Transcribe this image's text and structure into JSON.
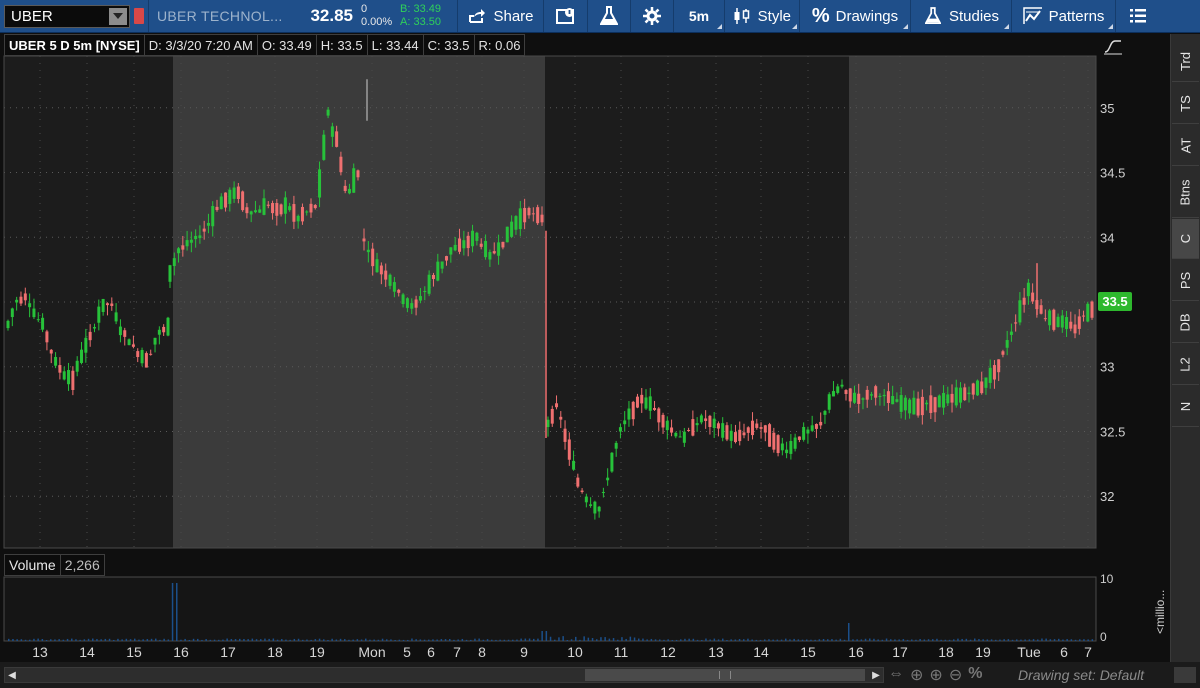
{
  "toolbar": {
    "symbol": "UBER",
    "company": "UBER TECHNOL...",
    "last": "32.85",
    "net_change": "0",
    "net_change_pct": "0.00%",
    "bid": "B: 33.49",
    "ask": "A: 33.50",
    "share_label": "Share",
    "aggregation": "5m",
    "style_label": "Style",
    "drawings_label": "Drawings",
    "studies_label": "Studies",
    "patterns_label": "Patterns",
    "link_color": "#d84848"
  },
  "chart_header": {
    "title": "UBER 5 D 5m [NYSE]",
    "date": "D: 3/3/20 7:20 AM",
    "open": "O: 33.49",
    "high": "H: 33.5",
    "low": "L: 33.44",
    "close": "C: 33.5",
    "range": "R: 0.06"
  },
  "volume": {
    "label": "Volume",
    "value": "2,266",
    "axis_max": "10",
    "axis_min": "0",
    "unit": "<millio..."
  },
  "sidebar": {
    "items": [
      "Trd",
      "TS",
      "AT",
      "Btns",
      "C",
      "PS",
      "DB",
      "L2",
      "N"
    ],
    "active": "C"
  },
  "bottom_bar": {
    "drawing_set": "Drawing set: Default"
  },
  "colors": {
    "up": "#27c23a",
    "down": "#f07070",
    "price_badge": "#2eb82e",
    "background_dark": "#1c1c1c",
    "background_session": "#3b3b3b"
  },
  "chart_data": {
    "type": "candlestick",
    "price_axis_ticks": [
      "35",
      "34.5",
      "34",
      "33.5",
      "33",
      "32.5",
      "32"
    ],
    "price_range": [
      31.6,
      35.4
    ],
    "current_price_label": "33.5",
    "time_axis_ticks": [
      "13",
      "14",
      "15",
      "16",
      "17",
      "18",
      "19",
      "Mon",
      "5",
      "6",
      "7",
      "8",
      "9",
      "10",
      "11",
      "12",
      "13",
      "14",
      "15",
      "16",
      "17",
      "18",
      "19",
      "Tue",
      "6",
      "7"
    ],
    "segments": [
      {
        "session": "extended",
        "start_bar": 0,
        "points": [
          33.3,
          33.5,
          33.55,
          33.4,
          33.3,
          33.05,
          32.95,
          32.9,
          33.1,
          33.25,
          33.45,
          33.5,
          33.3,
          33.2,
          33.1,
          33.05,
          33.25,
          33.3
        ]
      },
      {
        "session": "regular",
        "start_bar": 0,
        "points": [
          33.7,
          33.9,
          33.95,
          34.0,
          34.1,
          34.25,
          34.3,
          34.35,
          34.2,
          34.2,
          34.25,
          34.2,
          34.25,
          34.15,
          34.2,
          34.25,
          34.9,
          34.75,
          34.3,
          34.5
        ]
      },
      {
        "session": "regular",
        "start_bar": 0,
        "points": [
          34.0,
          33.8,
          33.7,
          33.55,
          33.45,
          33.6,
          33.75,
          33.9,
          33.95,
          34.0,
          33.85,
          33.95,
          34.1,
          34.2,
          34.15
        ]
      },
      {
        "session": "extended",
        "start_bar": 0,
        "points": [
          32.55,
          32.7,
          32.4,
          32.1,
          31.95,
          31.9,
          32.2,
          32.5,
          32.65,
          32.75,
          32.7,
          32.6,
          32.5,
          32.45,
          32.55,
          32.6,
          32.55,
          32.5,
          32.45,
          32.5,
          32.55,
          32.5,
          32.4,
          32.35,
          32.45,
          32.5,
          32.55,
          32.75,
          32.85
        ]
      },
      {
        "session": "regular",
        "start_bar": 0,
        "points": [
          32.8,
          32.75,
          32.8,
          32.75,
          32.7,
          32.7,
          32.72,
          32.75,
          32.8,
          32.85,
          33.0,
          33.3,
          33.6,
          33.4,
          33.35,
          33.3,
          33.45
        ]
      }
    ]
  }
}
